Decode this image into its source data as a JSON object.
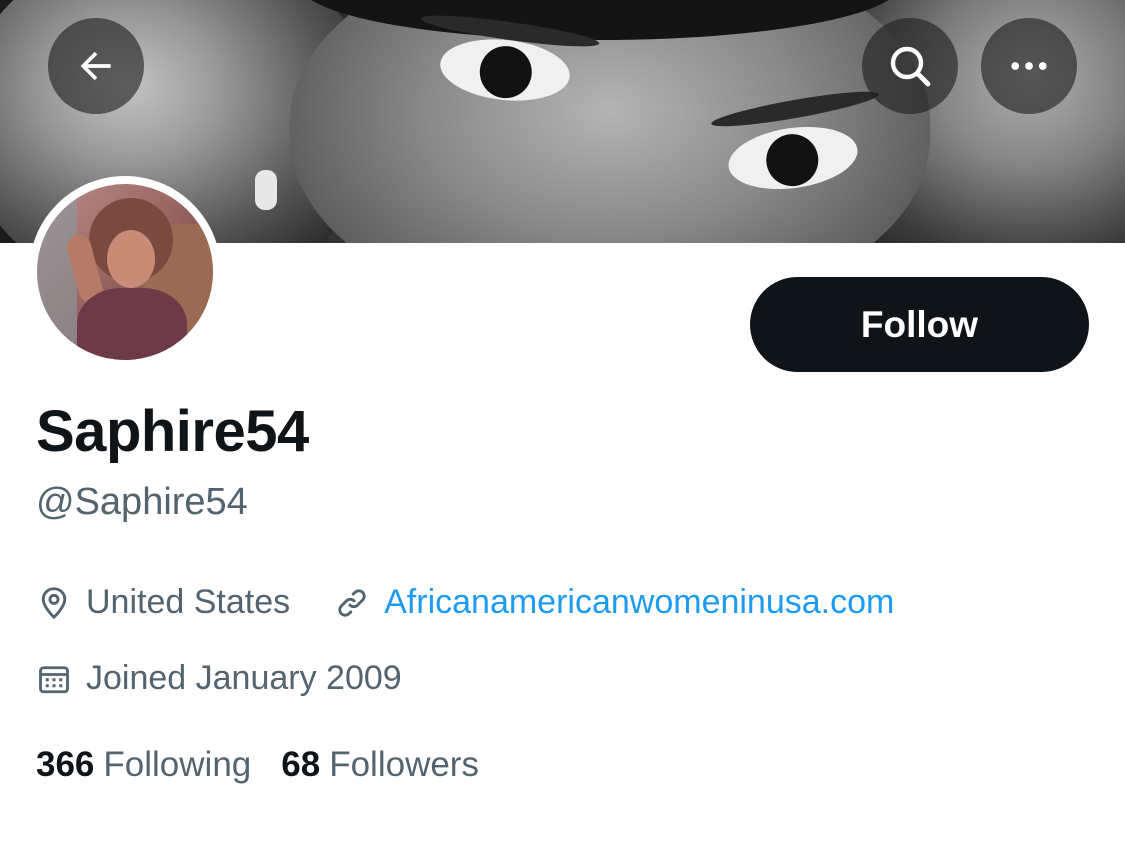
{
  "profile": {
    "display_name": "Saphire54",
    "handle": "@Saphire54",
    "location": "United States",
    "website": "Africanamericanwomeninusa.com",
    "joined": "Joined January 2009"
  },
  "actions": {
    "follow_label": "Follow"
  },
  "stats": {
    "following_count": "366",
    "following_label": "Following",
    "followers_count": "68",
    "followers_label": "Followers"
  },
  "icons": {
    "back": "arrow-left-icon",
    "search": "search-icon",
    "more": "more-horizontal-icon",
    "location": "location-pin-icon",
    "link": "link-icon",
    "calendar": "calendar-icon"
  },
  "colors": {
    "primary_text": "#0f1419",
    "secondary_text": "#536471",
    "link": "#1d9bf0",
    "follow_button_bg": "#0f1419"
  }
}
